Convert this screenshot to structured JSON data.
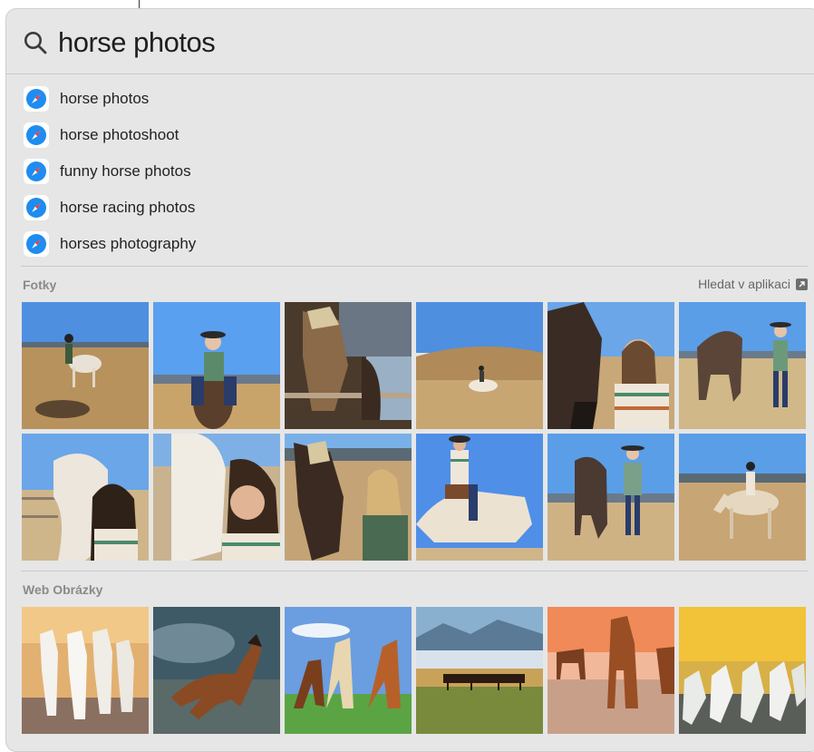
{
  "search": {
    "query": "horse photos"
  },
  "suggestions": [
    {
      "label": "horse photos",
      "icon": "safari-compass-icon"
    },
    {
      "label": "horse photoshoot",
      "icon": "safari-compass-icon"
    },
    {
      "label": "funny horse photos",
      "icon": "safari-compass-icon"
    },
    {
      "label": "horse racing photos",
      "icon": "safari-compass-icon"
    },
    {
      "label": "horses photography",
      "icon": "safari-compass-icon"
    }
  ],
  "photos_section": {
    "title": "Fotky",
    "action_label": "Hledat v aplikaci",
    "action_icon": "open-in-app-icon"
  },
  "web_images_section": {
    "title": "Web Obrázky"
  },
  "colors": {
    "panel_bg": "#e6e6e6",
    "safari_blue": "#1e8cf0",
    "secondary_text": "#8a8a8a"
  }
}
